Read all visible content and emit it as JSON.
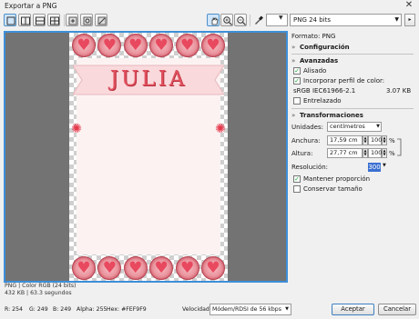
{
  "window": {
    "title": "Exportar a PNG",
    "close": "✕"
  },
  "toolbar": {
    "format": "PNG 24 bits",
    "next": "▸"
  },
  "preview": {
    "title_text": "JULIA",
    "top_hearts": 6,
    "bottom_hearts": 6
  },
  "panel": {
    "format_label": "Formato: PNG",
    "configuracion": "Configuración",
    "avanzadas": "Avanzadas",
    "alisado": "Alisado",
    "incorporar": "Incorporar perfil de color:",
    "profile": "sRGB IEC61966-2.1",
    "profile_size": "3.07 KB",
    "entrelazado": "Entrelazado",
    "transformaciones": "Transformaciones",
    "unidades_label": "Unidades:",
    "unidades_value": "centímetros",
    "anchura_label": "Anchura:",
    "anchura_value": "17,59 cm",
    "anchura_pct": "100",
    "altura_label": "Altura:",
    "altura_value": "27,77 cm",
    "altura_pct": "100",
    "pct": "%",
    "resolucion_label": "Resolución:",
    "resolucion_value": "300",
    "mantener": "Mantener proporción",
    "conservar": "Conservar tamaño",
    "check": "✓",
    "chevron": "»"
  },
  "info": {
    "line1": "PNG  |  Color RGB (24 bits)",
    "line2": "432 KB  |  63.3 segundos"
  },
  "status": {
    "r": "R: 254",
    "g": "G: 249",
    "b": "B: 249",
    "alpha": "Alpha: 255",
    "hex": "Hex: #FEF9F9",
    "velocidad_label": "Velocidad:",
    "velocidad_value": "Módem/RDSI de 56 kbps",
    "aceptar": "Aceptar",
    "cancelar": "Cancelar"
  }
}
